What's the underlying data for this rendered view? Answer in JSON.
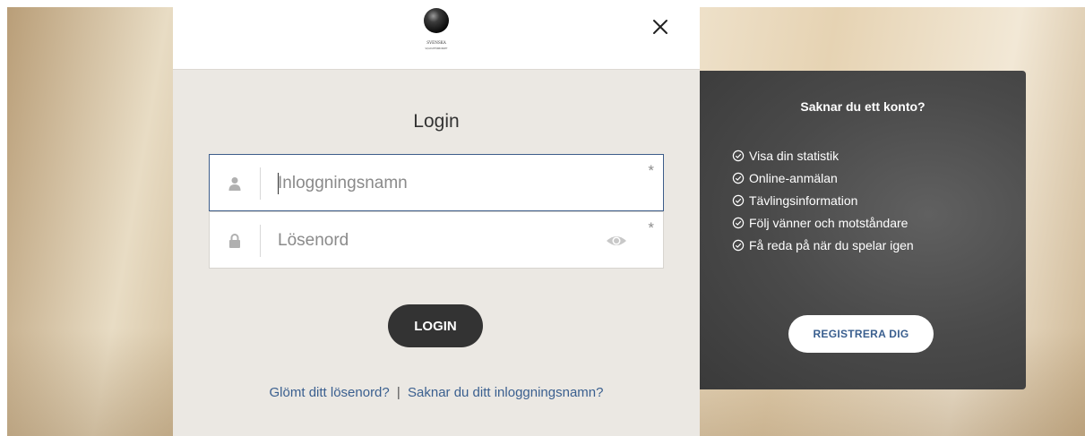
{
  "logo": {
    "text": "SVENSKA",
    "subtext": "SQUASHFÖRBUNDET"
  },
  "modal": {
    "close_icon": "close-icon",
    "title": "Login",
    "username": {
      "placeholder": "Inloggningsnamn",
      "value": "",
      "required_mark": "*",
      "icon": "user-icon"
    },
    "password": {
      "placeholder": "Lösenord",
      "value": "",
      "required_mark": "*",
      "icon": "lock-icon",
      "toggle_icon": "eye-icon"
    },
    "login_button": "LOGIN",
    "forgot_password_link": "Glömt ditt lösenord?",
    "separator": "|",
    "forgot_username_link": "Saknar du ditt inloggningsnamn?"
  },
  "register_panel": {
    "title": "Saknar du ett konto?",
    "features": [
      "Visa din statistik",
      "Online-anmälan",
      "Tävlingsinformation",
      "Följ vänner och motståndare",
      "Få reda på när du spelar igen"
    ],
    "register_button": "REGISTRERA DIG"
  },
  "colors": {
    "modal_bg": "#ebe8e3",
    "button_dark": "#333333",
    "link_blue": "#3a5f8f",
    "panel_bg": "#4a4a4a",
    "active_border": "#3d5d8a"
  }
}
